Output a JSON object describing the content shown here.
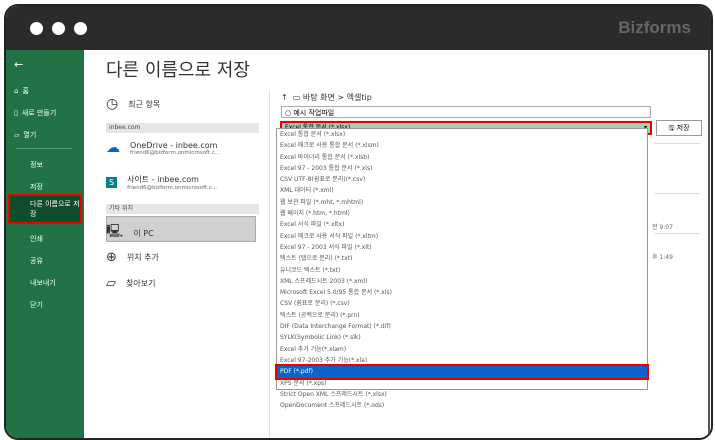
{
  "logo": "Bizforms",
  "sidebar": {
    "back": "←",
    "items": [
      "홈",
      "새로 만들기",
      "열기"
    ],
    "sub": [
      "정보",
      "저장",
      "다른 이름으로 저장",
      "인쇄",
      "공유",
      "내보내기",
      "닫기"
    ]
  },
  "title": "다른 이름으로 저장",
  "locations": {
    "recent": "최근 항목",
    "section1": "inbee.com",
    "onedrive": "OneDrive - inbee.com",
    "onedrive_sub": "friend6@bizform.onmicrosoft.c...",
    "site": "사이트 - inbee.com",
    "site_sub": "friend6@bizform.onmicrosoft.c...",
    "section2": "기타 위치",
    "pc": "이 PC",
    "add": "위치 추가",
    "browse": "찾아보기"
  },
  "path": {
    "crumb": "바탕 화면 > 엑셀tip",
    "filename": "예시 작업파일",
    "filetype": "Excel 통합 문서 (*.xlsx)",
    "save": "저장"
  },
  "files": [
    {
      "time": "전 9:07"
    },
    {
      "time": "후 1:49"
    }
  ],
  "filetypes": [
    "Excel 통합 문서 (*.xlsx)",
    "Excel 매크로 사용 통합 문서 (*.xlsm)",
    "Excel 바이너리 통합 문서 (*.xlsb)",
    "Excel 97 - 2003 통합 문서 (*.xls)",
    "CSV UTF-8(쉼표로 분리)(*.csv)",
    "XML 데이터 (*.xml)",
    "웹 보관 파일 (*.mht, *.mhtml)",
    "웹 페이지 (*.htm, *.html)",
    "Excel 서식 파일 (*.xltx)",
    "Excel 매크로 사용 서식 파일 (*.xltm)",
    "Excel 97 - 2003 서식 파일 (*.xlt)",
    "텍스트 (탭으로 분리) (*.txt)",
    "유니코드 텍스트 (*.txt)",
    "XML 스프레드시트 2003 (*.xml)",
    "Microsoft Excel 5.0/95 통합 문서 (*.xls)",
    "CSV (쉼표로 분리) (*.csv)",
    "텍스트 (공백으로 분리) (*.prn)",
    "DIF (Data Interchange Format) (*.dif)",
    "SYLK(Symbolic Link) (*.slk)",
    "Excel 추가 기능(*.xlam)",
    "Excel 97-2003 추가 기능(*.xla)",
    "PDF (*.pdf)",
    "XPS 문서 (*.xps)",
    "Strict Open XML 스프레드시트 (*.xlsx)",
    "OpenDocument 스프레드시트 (*.ods)"
  ],
  "selected_index": 21
}
